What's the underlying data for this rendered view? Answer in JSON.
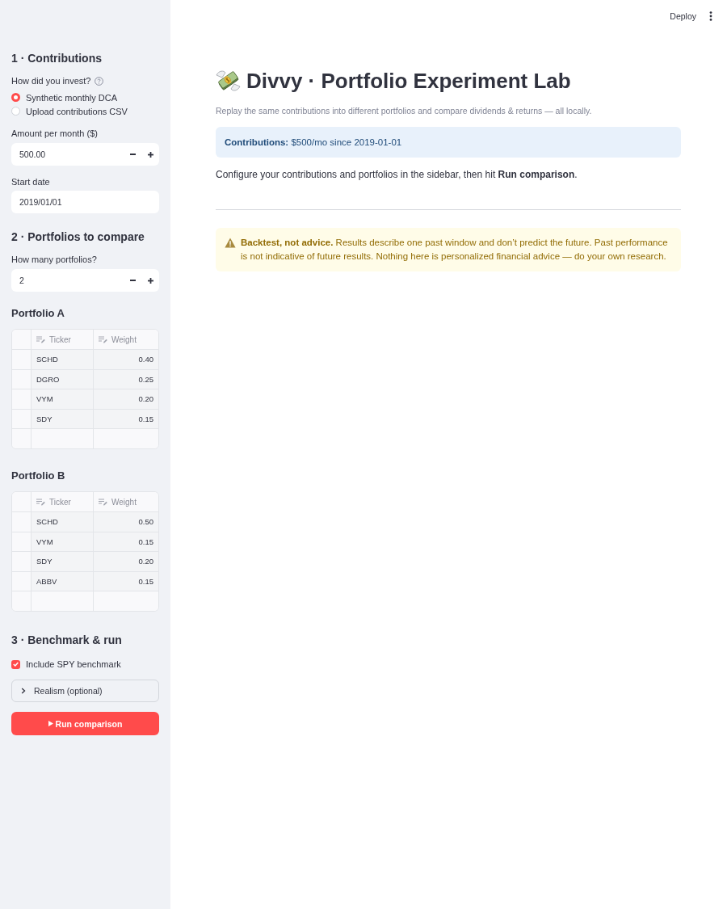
{
  "toolbar": {
    "deploy_label": "Deploy"
  },
  "sidebar": {
    "contributions": {
      "heading": "1 · Contributions",
      "method": {
        "label": "How did you invest?",
        "options": [
          {
            "label": "Synthetic monthly DCA",
            "selected": true
          },
          {
            "label": "Upload contributions CSV",
            "selected": false
          }
        ]
      },
      "amount": {
        "label": "Amount per month ($)",
        "value": "500.00"
      },
      "start_date": {
        "label": "Start date",
        "value": "2019/01/01"
      }
    },
    "portfolios": {
      "heading": "2 · Portfolios to compare",
      "count": {
        "label": "How many portfolios?",
        "value": "2"
      },
      "tables": [
        {
          "title": "Portfolio A",
          "columns": [
            "Ticker",
            "Weight"
          ],
          "rows": [
            [
              "SCHD",
              "0.40"
            ],
            [
              "DGRO",
              "0.25"
            ],
            [
              "VYM",
              "0.20"
            ],
            [
              "SDY",
              "0.15"
            ]
          ]
        },
        {
          "title": "Portfolio B",
          "columns": [
            "Ticker",
            "Weight"
          ],
          "rows": [
            [
              "SCHD",
              "0.50"
            ],
            [
              "VYM",
              "0.15"
            ],
            [
              "SDY",
              "0.20"
            ],
            [
              "ABBV",
              "0.15"
            ]
          ]
        }
      ]
    },
    "run": {
      "heading": "3 · Benchmark & run",
      "benchmark": {
        "label": "Include SPY benchmark",
        "checked": true
      },
      "realism": {
        "label": "Realism (optional)",
        "expanded": false
      },
      "button": "Run comparison"
    }
  },
  "main": {
    "title": "Divvy · Portfolio Experiment Lab",
    "caption": "Replay the same contributions into different portfolios and compare dividends & returns — all locally.",
    "info": "**Contributions:** $500/mo since 2019-01-01",
    "instructions": "Configure your contributions and portfolios in the sidebar, then hit **Run comparison**.",
    "warning": "**Backtest, not advice.** Results describe one past window and don’t predict the future. Past performance is not indicative of future results. Nothing here is personalized financial advice — do your own research."
  }
}
